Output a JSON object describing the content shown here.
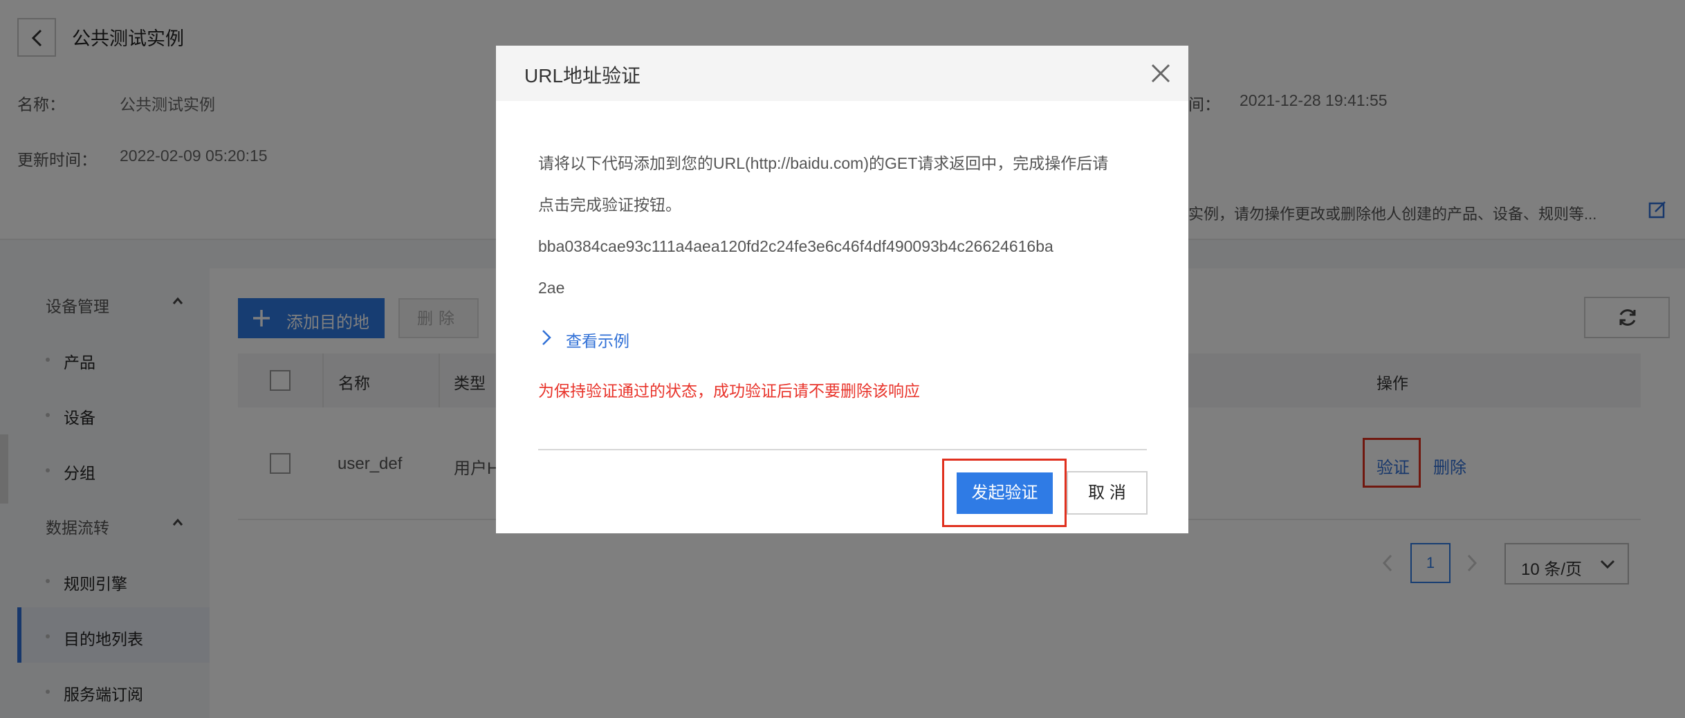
{
  "header": {
    "title": "公共测试实例",
    "name_label": "名称：",
    "name_value": "公共测试实例",
    "created_label_partial": "间：",
    "created_value": "2021-12-28 19:41:55",
    "updated_label": "更新时间：",
    "updated_value": "2022-02-09 05:20:15",
    "notice_partial": "实例，请勿操作更改或删除他人创建的产品、设备、规则等..."
  },
  "sidebar": {
    "groups": [
      {
        "label": "设备管理",
        "items": [
          "产品",
          "设备",
          "分组"
        ]
      },
      {
        "label": "数据流转",
        "items": [
          "规则引擎",
          "目的地列表",
          "服务端订阅"
        ]
      }
    ],
    "active_item": "目的地列表"
  },
  "toolbar": {
    "add_label": "添加目的地",
    "delete_label": "删除"
  },
  "table": {
    "columns": [
      "名称",
      "类型",
      "操作"
    ],
    "rows": [
      {
        "name": "user_def",
        "type_partial": "用户H",
        "actions": [
          "验证",
          "删除"
        ]
      }
    ]
  },
  "pagination": {
    "current_page": "1",
    "page_size": "10 条/页"
  },
  "modal": {
    "title": "URL地址验证",
    "instruction_line1": "请将以下代码添加到您的URL(http://baidu.com)的GET请求返回中，完成操作后请",
    "instruction_line2": "点击完成验证按钮。",
    "code_line1": "bba0384cae93c111a4aea120fd2c24fe3e6c46f4df490093b4c26624616ba",
    "code_line2": "2ae",
    "example_link": "查看示例",
    "warning": "为保持验证通过的状态，成功验证后请不要删除该响应",
    "verify_button": "发起验证",
    "cancel_button": "取 消"
  },
  "colors": {
    "primary": "#2f7be5",
    "link": "#2f6fd6",
    "warning": "#e8332a",
    "highlight_box": "#e0301e"
  }
}
